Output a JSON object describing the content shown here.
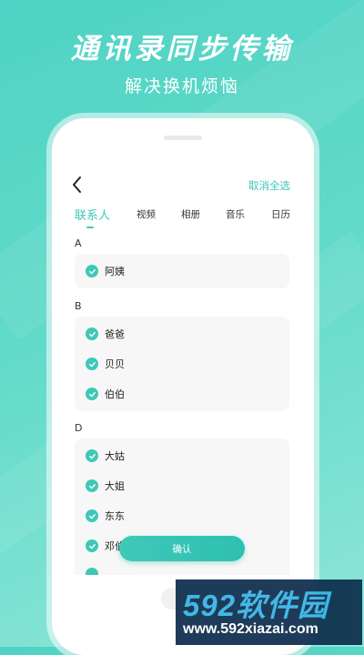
{
  "promo": {
    "headline": "通讯录同步传输",
    "subline": "解决换机烦恼"
  },
  "app": {
    "deselect_all": "取消全选",
    "tabs": [
      {
        "label": "联系人",
        "active": true
      },
      {
        "label": "视频",
        "active": false
      },
      {
        "label": "相册",
        "active": false
      },
      {
        "label": "音乐",
        "active": false
      },
      {
        "label": "日历",
        "active": false
      }
    ],
    "sections": [
      {
        "letter": "A",
        "contacts": [
          "阿姨"
        ]
      },
      {
        "letter": "B",
        "contacts": [
          "爸爸",
          "贝贝",
          "伯伯"
        ]
      },
      {
        "letter": "D",
        "contacts": [
          "大姑",
          "大姐",
          "东东",
          "邓伯"
        ]
      }
    ],
    "confirm_label": "确认"
  },
  "watermark": {
    "brand": "592软件园",
    "url": "www.592xiazai.com"
  },
  "colors": {
    "accent": "#3fc8b8",
    "background": "#56d6c6"
  }
}
